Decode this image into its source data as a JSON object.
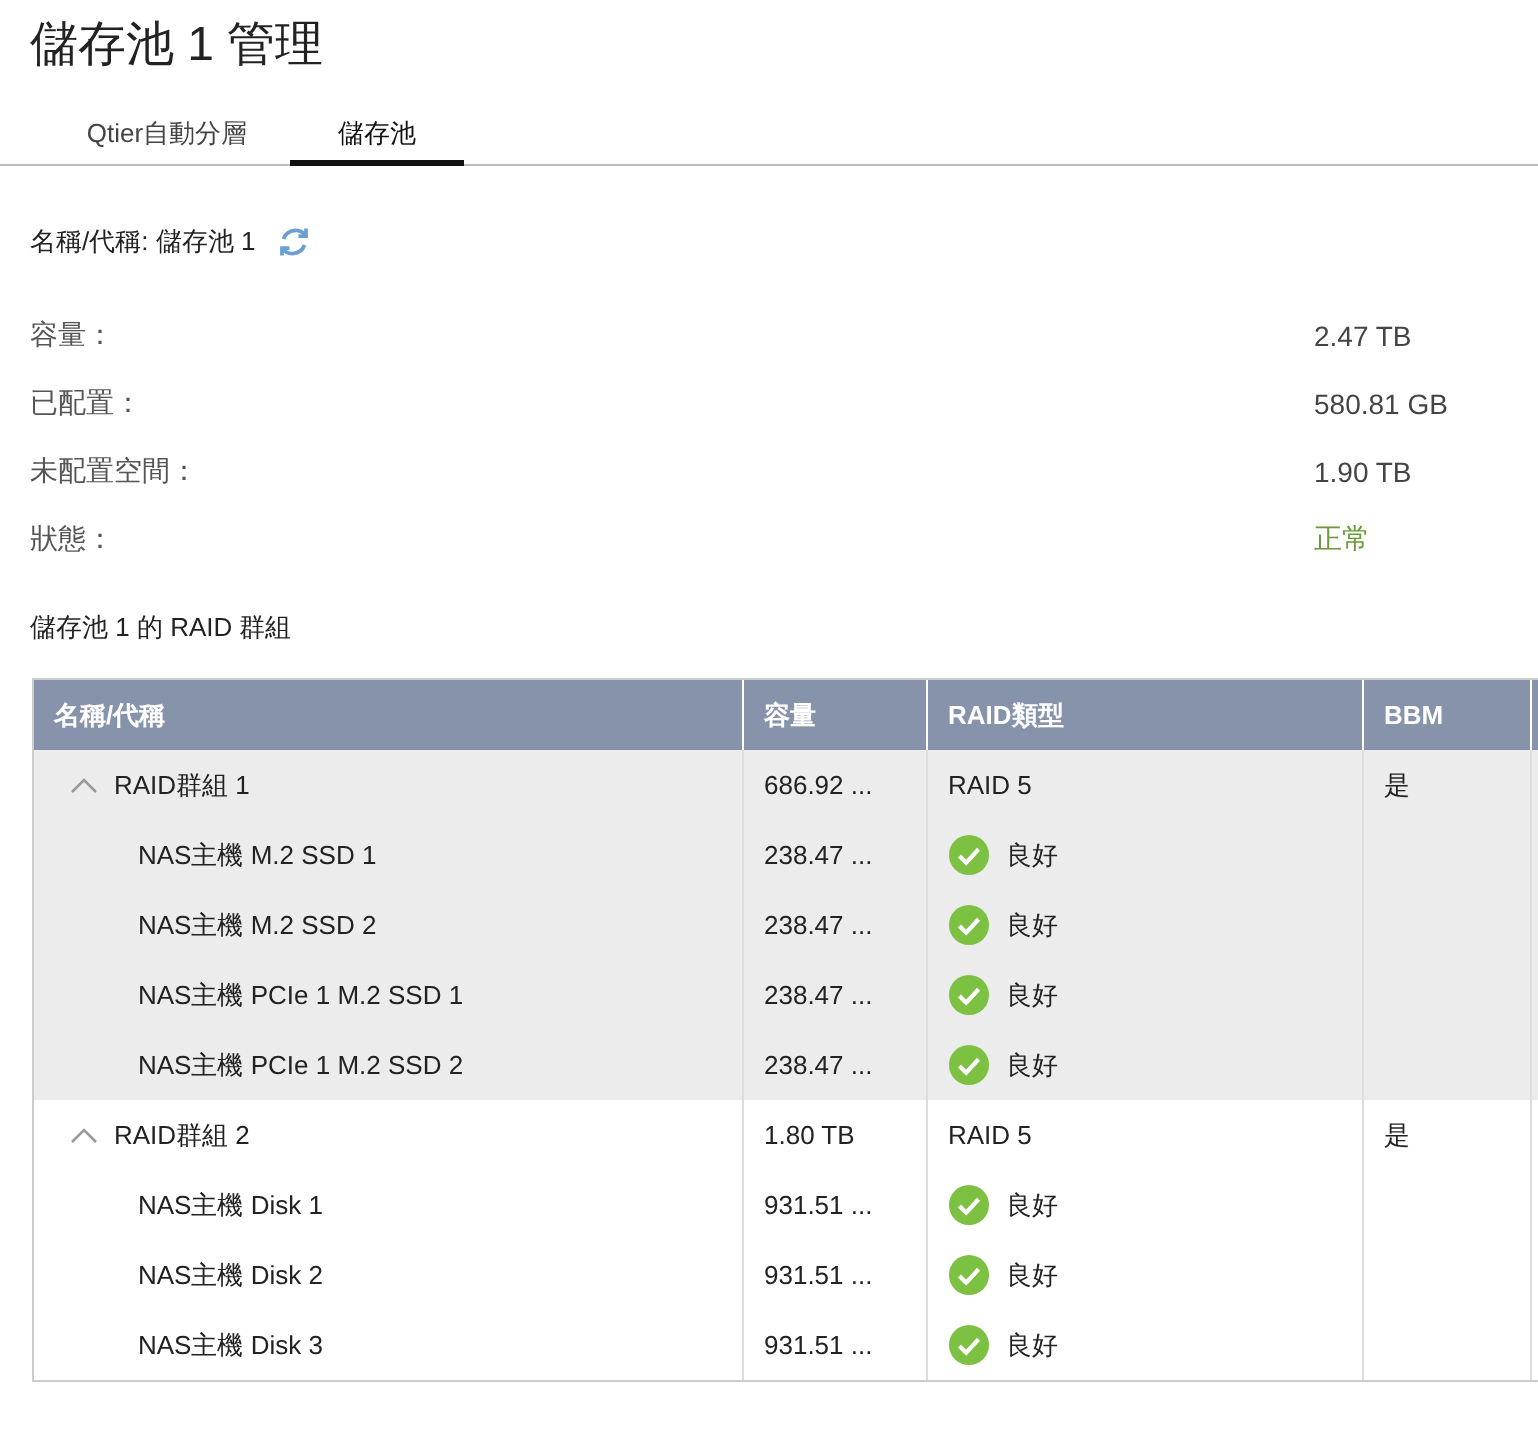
{
  "title": "儲存池 1 管理",
  "tabs": [
    {
      "label": "Qtier自動分層",
      "selected": false
    },
    {
      "label": "儲存池",
      "selected": true
    }
  ],
  "pool_name": {
    "label": "名稱/代稱: 儲存池 1"
  },
  "info": [
    {
      "label": "容量：",
      "value": "2.47 TB",
      "kind": "plain"
    },
    {
      "label": "已配置：",
      "value": "580.81 GB",
      "kind": "plain"
    },
    {
      "label": "未配置空間：",
      "value": "1.90 TB",
      "kind": "plain"
    },
    {
      "label": "狀態：",
      "value": "正常",
      "kind": "status"
    }
  ],
  "section_title": "儲存池 1 的 RAID 群組",
  "table": {
    "columns": [
      "名稱/代稱",
      "容量",
      "RAID類型",
      "BBM"
    ],
    "groups": [
      {
        "name": "RAID群組 1",
        "capacity": "686.92 ...",
        "raid_type": "RAID 5",
        "bbm": "是",
        "expanded": true,
        "selected": true,
        "children": [
          {
            "name": "NAS主機 M.2 SSD 1",
            "capacity": "238.47 ...",
            "status": "良好"
          },
          {
            "name": "NAS主機 M.2 SSD 2",
            "capacity": "238.47 ...",
            "status": "良好"
          },
          {
            "name": "NAS主機 PCIe 1 M.2 SSD 1",
            "capacity": "238.47 ...",
            "status": "良好"
          },
          {
            "name": "NAS主機 PCIe 1 M.2 SSD 2",
            "capacity": "238.47 ...",
            "status": "良好"
          }
        ]
      },
      {
        "name": "RAID群組 2",
        "capacity": "1.80 TB",
        "raid_type": "RAID 5",
        "bbm": "是",
        "expanded": true,
        "selected": false,
        "children": [
          {
            "name": "NAS主機 Disk 1",
            "capacity": "931.51 ...",
            "status": "良好"
          },
          {
            "name": "NAS主機 Disk 2",
            "capacity": "931.51 ...",
            "status": "良好"
          },
          {
            "name": "NAS主機 Disk 3",
            "capacity": "931.51 ...",
            "status": "良好"
          }
        ]
      }
    ]
  }
}
